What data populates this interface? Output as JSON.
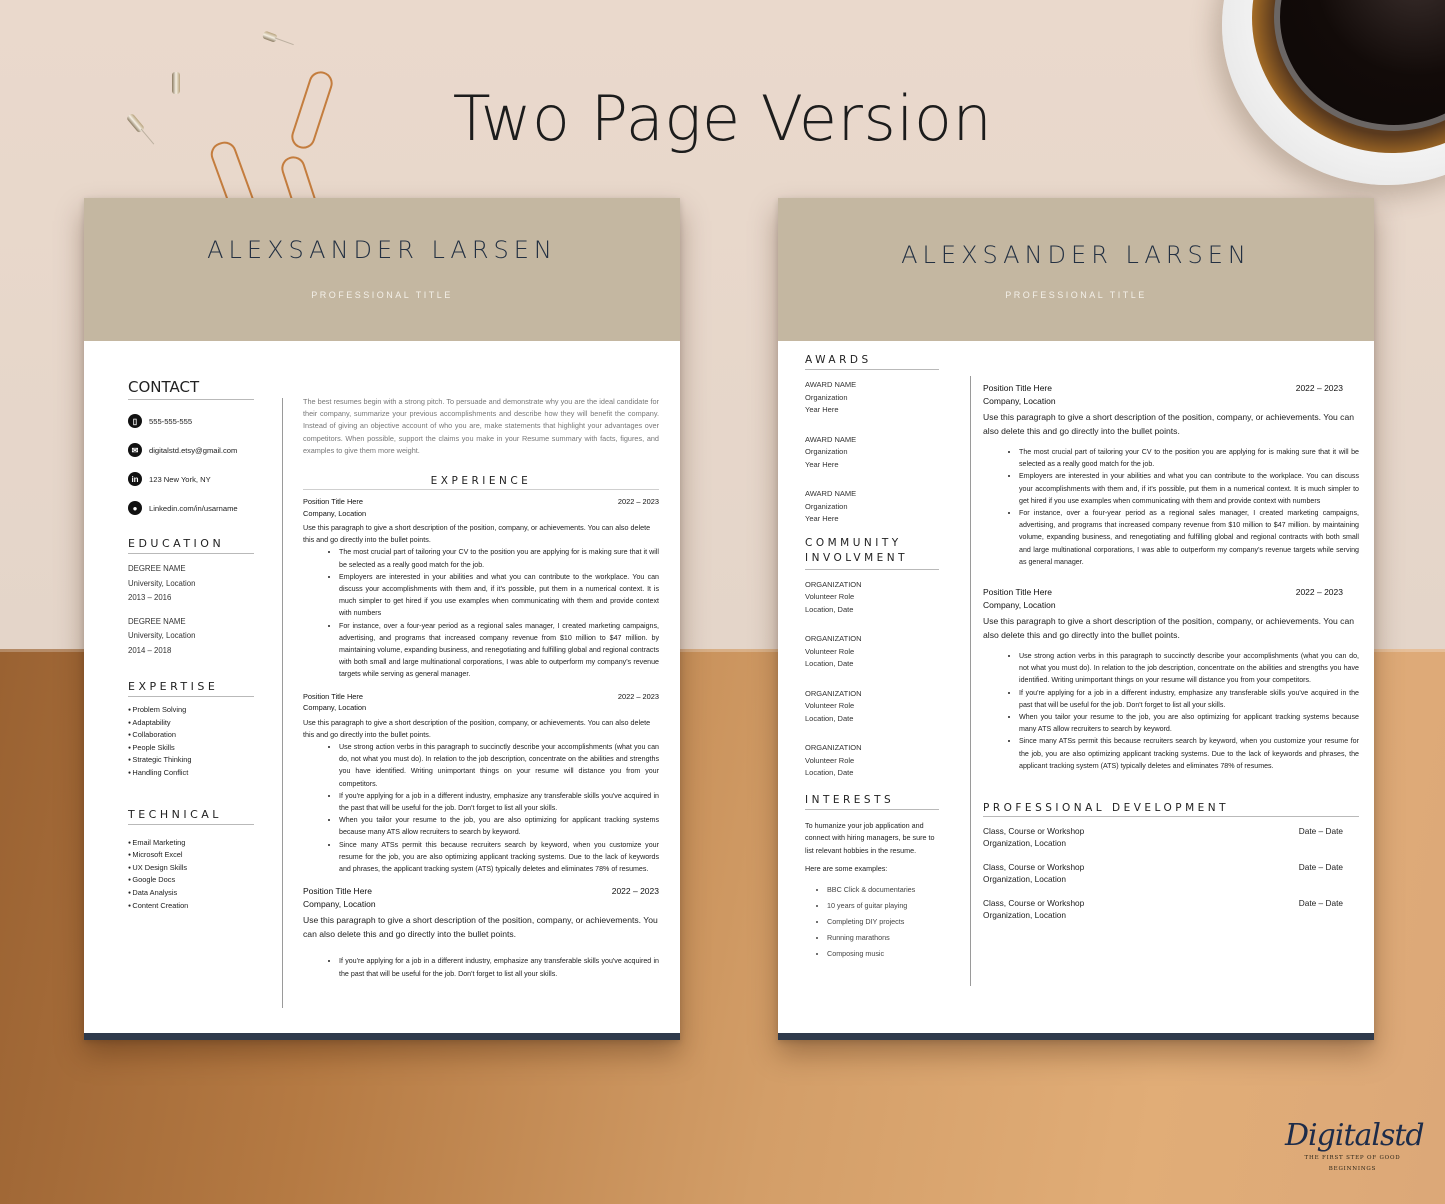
{
  "headline": "Two Page Version",
  "colors": {
    "header_band": "#c4b7a1",
    "name_text": "#233042",
    "footer_bar": "#2f3a4b",
    "background_top": "#e6d8cc",
    "background_bottom": "#c58a52"
  },
  "resume": {
    "name": "ALEXSANDER LARSEN",
    "professional_title": "PROFESSIONAL TITLE"
  },
  "page1": {
    "contact": {
      "title": "CONTACT",
      "items": [
        {
          "icon": "phone-icon",
          "glyph": "▯",
          "text": "555-555-555"
        },
        {
          "icon": "email-icon",
          "glyph": "✉",
          "text": "digitalstd.etsy@gmail.com"
        },
        {
          "icon": "linkedin-icon",
          "glyph": "in",
          "text": "123 New York, NY"
        },
        {
          "icon": "location-pin-icon",
          "glyph": "●",
          "text": "Linkedin.com/in/usarname"
        }
      ]
    },
    "education": {
      "title": "EDUCATION",
      "items": [
        {
          "degree": "DEGREE NAME",
          "school": "University, Location",
          "years": "2013 – 2016"
        },
        {
          "degree": "DEGREE NAME",
          "school": "University, Location",
          "years": "2014 – 2018"
        }
      ]
    },
    "expertise": {
      "title": "EXPERTISE",
      "items": [
        "Problem Solving",
        "Adaptability",
        "Collaboration",
        "People Skills",
        "Strategic Thinking",
        "Handling Conflict"
      ]
    },
    "technical": {
      "title": "TECHNICAL",
      "items": [
        "Email Marketing",
        "Microsoft Excel",
        "UX Design Skills",
        "Google Docs",
        "Data Analysis",
        "Content Creation"
      ]
    },
    "summary": "The best resumes begin with a strong pitch. To persuade and demonstrate why you are the ideal candidate for their company, summarize your previous accomplishments and describe how they will benefit the company. Instead of giving an objective account of who you are, make statements that highlight your advantages over competitors. When possible, support the claims you make in your Resume summary with facts, figures, and examples to give them more weight.",
    "experience_title": "EXPERIENCE",
    "jobs": [
      {
        "position": "Position Title Here",
        "dates": "2022 – 2023",
        "company": "Company, Location",
        "description": "Use this paragraph to give a short description of the position, company, or achievements. You can also delete this and go directly into the bullet points.",
        "bullets": [
          "The most crucial part of tailoring your CV to the position you are applying for is making sure that it will be selected as a really good match for the job.",
          "Employers are interested in your abilities and what you can contribute to the workplace. You can discuss your accomplishments with them and, if it's possible, put them in a numerical context. It is much simpler to get hired if you use examples when communicating with them and provide context with numbers",
          "For instance, over a four-year period as a regional sales manager, I created marketing campaigns, advertising, and programs that increased company revenue from $10 million to $47 million. by maintaining volume, expanding business, and renegotiating and fulfilling global and regional contracts with both small and large multinational corporations, I was able to outperform my company's revenue targets while serving as general manager."
        ]
      },
      {
        "position": "Position Title Here",
        "dates": "2022 – 2023",
        "company": "Company, Location",
        "description": "Use this paragraph to give a short description of the position, company, or achievements. You can also delete this and go directly into the bullet points.",
        "bullets": [
          "Use strong action verbs in this paragraph to succinctly describe your accomplishments (what you can do, not what you must do). In relation to the job description, concentrate on the abilities and strengths you have identified. Writing unimportant things on your resume will distance you from your competitors.",
          "If you're applying for a job in a different industry, emphasize any transferable skills you've acquired in the past that will be useful for the job. Don't forget to list all your skills.",
          "When you tailor your resume to the job, you are also optimizing for applicant tracking systems because many ATS allow recruiters to search by keyword.",
          "Since many ATSs permit this because recruiters search by keyword, when you customize your resume for the job, you are also optimizing applicant tracking systems. Due to the lack of keywords and phrases, the applicant tracking system (ATS) typically deletes and eliminates 78% of resumes."
        ]
      },
      {
        "position": "Position Title Here",
        "dates": "2022 – 2023",
        "company": "Company, Location",
        "description": "Use this paragraph to give a short description of the position, company, or achievements. You can also delete this and go directly into the bullet points.",
        "bullets": [
          "If you're applying for a job in a different industry, emphasize any transferable skills you've acquired in the past that will be useful for the job. Don't forget to list all your skills."
        ]
      }
    ]
  },
  "page2": {
    "awards": {
      "title": "AWARDS",
      "items": [
        {
          "name": "AWARD NAME",
          "org": "Organization",
          "year": "Year Here"
        },
        {
          "name": "AWARD NAME",
          "org": "Organization",
          "year": "Year Here"
        },
        {
          "name": "AWARD NAME",
          "org": "Organization",
          "year": "Year Here"
        }
      ]
    },
    "community": {
      "title_line1": "COMMUNITY",
      "title_line2": "INVOLVMENT",
      "items": [
        {
          "org": "ORGANIZATION",
          "role": "Volunteer Role",
          "place": "Location, Date"
        },
        {
          "org": "ORGANIZATION",
          "role": "Volunteer Role",
          "place": "Location, Date"
        },
        {
          "org": "ORGANIZATION",
          "role": "Volunteer Role",
          "place": "Location, Date"
        },
        {
          "org": "ORGANIZATION",
          "role": "Volunteer Role",
          "place": "Location, Date"
        }
      ]
    },
    "interests": {
      "title": "INTERESTS",
      "text": "To humanize your job application and connect with hiring managers, be sure to list relevant hobbies in the resume.",
      "examples_label": "Here are some examples:",
      "items": [
        "BBC Click & documentaries",
        "10 years of guitar playing",
        "Completing DIY projects",
        "Running marathons",
        "Composing music"
      ]
    },
    "jobs": [
      {
        "position": "Position Title Here",
        "dates": "2022 – 2023",
        "company": "Company, Location",
        "description": "Use this paragraph to give a short description of the position, company, or achievements. You can also delete this and go directly into the bullet points.",
        "bullets": [
          "The most crucial part of tailoring your CV to the position you are applying for is making sure that it will be selected as a really good match for the job.",
          "Employers are interested in your abilities and what you can contribute to the workplace. You can discuss your accomplishments with them and, if it's possible, put them in a numerical context. It is much simpler to get hired if you use examples when communicating with them and provide context with numbers",
          "For instance, over a four-year period as a regional sales manager, I created marketing campaigns, advertising, and programs that increased company revenue from $10 million to $47 million. by maintaining volume, expanding business, and renegotiating and fulfilling global and regional contracts with both small and large multinational corporations, I was able to outperform my company's revenue targets while serving as general manager."
        ]
      },
      {
        "position": "Position Title Here",
        "dates": "2022 – 2023",
        "company": "Company, Location",
        "description": "Use this paragraph to give a short description of the position, company, or achievements. You can also delete this and go directly into the bullet points.",
        "bullets": [
          "Use strong action verbs in this paragraph to succinctly describe your accomplishments (what you can do, not what you must do). In relation to the job description, concentrate on the abilities and strengths you have identified. Writing unimportant things on your resume will distance you from your competitors.",
          "If you're applying for a job in a different industry, emphasize any transferable skills you've acquired in the past that will be useful for the job. Don't forget to list all your skills.",
          "When you tailor your resume to the job, you are also optimizing for applicant tracking systems because many ATS allow recruiters to search by keyword.",
          "Since many ATSs permit this because recruiters search by keyword, when you customize your resume for the job, you are also optimizing applicant tracking systems. Due to the lack of keywords and phrases, the applicant tracking system (ATS) typically deletes and eliminates 78% of resumes."
        ]
      }
    ],
    "professional_development": {
      "title": "PROFESSIONAL DEVELOPMENT",
      "items": [
        {
          "course": "Class, Course or Workshop",
          "org": "Organization, Location",
          "dates": "Date – Date"
        },
        {
          "course": "Class, Course or Workshop",
          "org": "Organization, Location",
          "dates": "Date – Date"
        },
        {
          "course": "Class, Course or Workshop",
          "org": "Organization, Location",
          "dates": "Date – Date"
        }
      ]
    }
  },
  "brand": {
    "name": "Digitalstd",
    "tagline_line1": "THE FIRST STEP OF GOOD",
    "tagline_line2": "BEGINNINGS"
  }
}
